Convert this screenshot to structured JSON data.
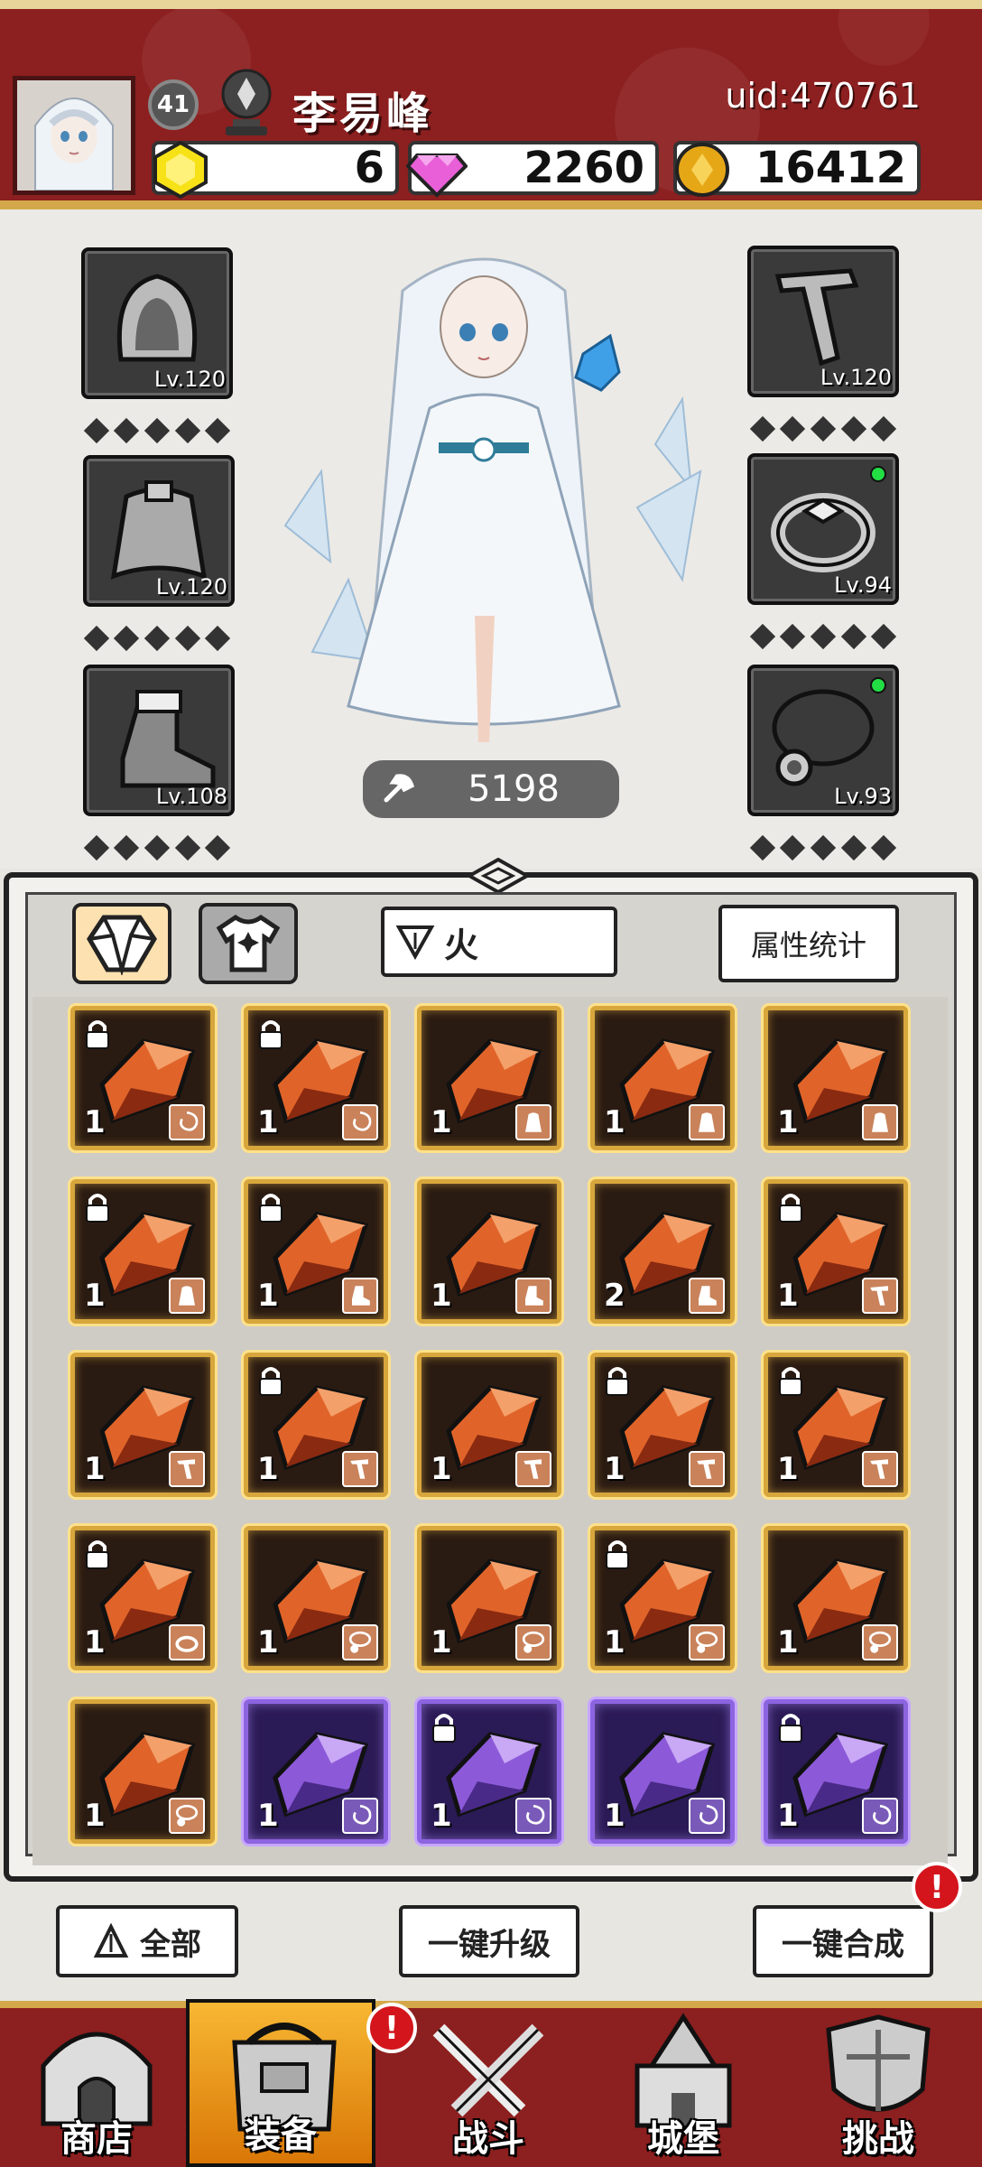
{
  "player": {
    "level": "41",
    "name": "李易峰",
    "uid": "uid:470761"
  },
  "resources": {
    "gem": "6",
    "diamond": "2260",
    "coin": "16412"
  },
  "colors": {
    "header_red": "#8c1f1f",
    "gold_border": "#d4a84a",
    "rarity_gold": "#d7a63c",
    "rarity_purple": "#8d64e0",
    "alert_red": "#d4151c"
  },
  "equipment": {
    "left": [
      {
        "icon": "hood-icon",
        "level": "Lv.120"
      },
      {
        "icon": "cape-icon",
        "level": "Lv.120"
      },
      {
        "icon": "boot-icon",
        "level": "Lv.108"
      }
    ],
    "right": [
      {
        "icon": "pipe-weapon-icon",
        "level": "Lv.120"
      },
      {
        "icon": "ring-icon",
        "level": "Lv.94"
      },
      {
        "icon": "necklace-icon",
        "level": "Lv.93"
      }
    ]
  },
  "combat_power": "5198",
  "inventory": {
    "filter_label": "火",
    "stats_button": "属性统计",
    "items": [
      {
        "qty": "1",
        "locked": true,
        "rarity": "gold",
        "type": "swirl"
      },
      {
        "qty": "1",
        "locked": true,
        "rarity": "gold",
        "type": "swirl"
      },
      {
        "qty": "1",
        "locked": false,
        "rarity": "gold",
        "type": "cape"
      },
      {
        "qty": "1",
        "locked": false,
        "rarity": "gold",
        "type": "cape"
      },
      {
        "qty": "1",
        "locked": false,
        "rarity": "gold",
        "type": "cape"
      },
      {
        "qty": "1",
        "locked": true,
        "rarity": "gold",
        "type": "cape"
      },
      {
        "qty": "1",
        "locked": true,
        "rarity": "gold",
        "type": "boot"
      },
      {
        "qty": "1",
        "locked": false,
        "rarity": "gold",
        "type": "boot"
      },
      {
        "qty": "2",
        "locked": false,
        "rarity": "gold",
        "type": "boot"
      },
      {
        "qty": "1",
        "locked": true,
        "rarity": "gold",
        "type": "weapon"
      },
      {
        "qty": "1",
        "locked": false,
        "rarity": "gold",
        "type": "weapon"
      },
      {
        "qty": "1",
        "locked": true,
        "rarity": "gold",
        "type": "weapon"
      },
      {
        "qty": "1",
        "locked": false,
        "rarity": "gold",
        "type": "weapon"
      },
      {
        "qty": "1",
        "locked": true,
        "rarity": "gold",
        "type": "weapon"
      },
      {
        "qty": "1",
        "locked": true,
        "rarity": "gold",
        "type": "weapon"
      },
      {
        "qty": "1",
        "locked": true,
        "rarity": "gold",
        "type": "ring"
      },
      {
        "qty": "1",
        "locked": false,
        "rarity": "gold",
        "type": "necklace"
      },
      {
        "qty": "1",
        "locked": false,
        "rarity": "gold",
        "type": "necklace"
      },
      {
        "qty": "1",
        "locked": true,
        "rarity": "gold",
        "type": "necklace"
      },
      {
        "qty": "1",
        "locked": false,
        "rarity": "gold",
        "type": "necklace"
      },
      {
        "qty": "1",
        "locked": false,
        "rarity": "gold",
        "type": "necklace"
      },
      {
        "qty": "1",
        "locked": false,
        "rarity": "purple",
        "type": "swirl"
      },
      {
        "qty": "1",
        "locked": true,
        "rarity": "purple",
        "type": "swirl"
      },
      {
        "qty": "1",
        "locked": false,
        "rarity": "purple",
        "type": "swirl"
      },
      {
        "qty": "1",
        "locked": true,
        "rarity": "purple",
        "type": "swirl"
      }
    ]
  },
  "buttons": {
    "all": "全部",
    "upgrade_all": "一键升级",
    "merge_all": "一键合成",
    "alert_mark": "!"
  },
  "nav": [
    {
      "label": "商店",
      "icon": "shop-icon",
      "active": false,
      "alert": false
    },
    {
      "label": "装备",
      "icon": "backpack-icon",
      "active": true,
      "alert": true
    },
    {
      "label": "战斗",
      "icon": "crossed-swords-icon",
      "active": false,
      "alert": false
    },
    {
      "label": "城堡",
      "icon": "castle-icon",
      "active": false,
      "alert": false
    },
    {
      "label": "挑战",
      "icon": "shield-icon",
      "active": false,
      "alert": false
    }
  ]
}
